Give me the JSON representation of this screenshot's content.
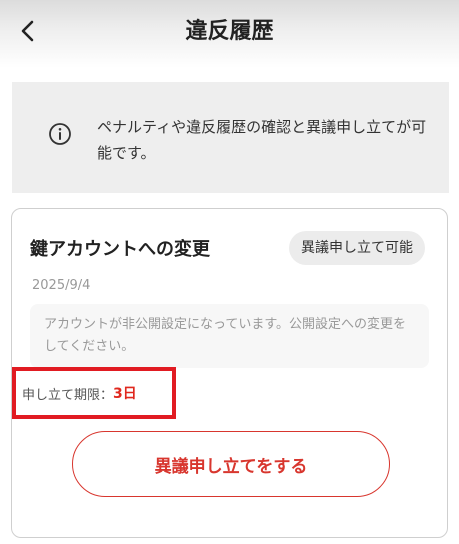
{
  "header": {
    "title": "違反履歴",
    "back_icon": "chevron-left-icon"
  },
  "info": {
    "icon": "info-circle-icon",
    "text": "ペナルティや違反履歴の確認と異議申し立てが可能です。"
  },
  "violation": {
    "title": "鍵アカウントへの変更",
    "badge": "異議申し立て可能",
    "date": "2025/9/4",
    "message": "アカウントが非公開設定になっています。公開設定への変更をしてください。",
    "deadline_label": "申し立て期限：",
    "deadline_value": "3日",
    "appeal_button": "異議申し立てをする"
  },
  "colors": {
    "accent": "#d8362e",
    "highlight_box": "#e11b22"
  }
}
